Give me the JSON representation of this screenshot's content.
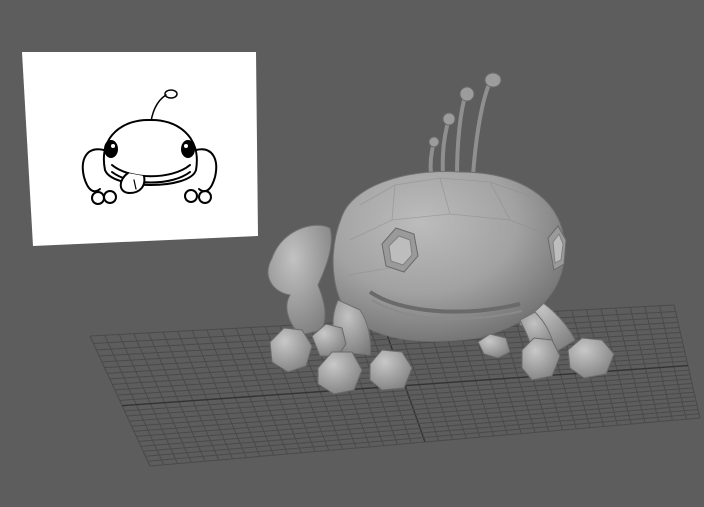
{
  "viewport": {
    "background_color": "#5d5d5d",
    "grid_color": "#4a4a4a",
    "grid_axis_color": "#333333",
    "model_shade_light": "#b4b4b4",
    "model_shade_mid": "#969696",
    "model_shade_dark": "#6c6c6c",
    "image_plane_color": "#ffffff",
    "sketch_ink_color": "#000000"
  },
  "scene": {
    "image_plane": {
      "content": "concept-sketch-creature"
    },
    "model": {
      "content": "creature-low-poly-mesh",
      "antennae_count": 4,
      "legs_count": 4
    }
  }
}
